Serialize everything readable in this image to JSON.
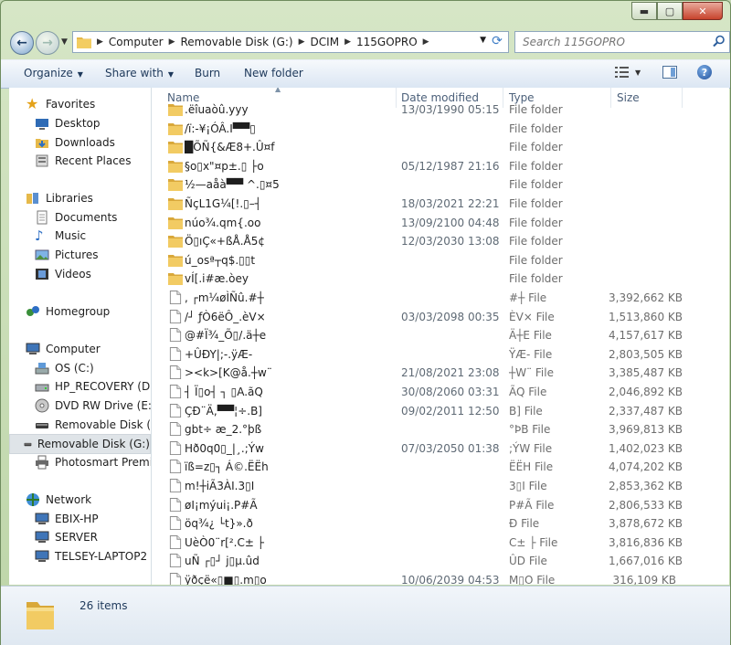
{
  "address": {
    "segments": [
      "Computer",
      "Removable Disk (G:)",
      "DCIM",
      "115GOPRO"
    ]
  },
  "search": {
    "placeholder": "Search 115GOPRO"
  },
  "toolbar": {
    "organize": "Organize",
    "share_with": "Share with",
    "burn": "Burn",
    "new_folder": "New folder"
  },
  "columns": {
    "name": "Name",
    "date": "Date modified",
    "type": "Type",
    "size": "Size"
  },
  "nav": {
    "favorites": "Favorites",
    "desktop": "Desktop",
    "downloads": "Downloads",
    "recent": "Recent Places",
    "libraries": "Libraries",
    "documents": "Documents",
    "music": "Music",
    "pictures": "Pictures",
    "videos": "Videos",
    "homegroup": "Homegroup",
    "computer": "Computer",
    "os": "OS (C:)",
    "recovery": "HP_RECOVERY (D:)",
    "dvd": "DVD RW Drive (E:)",
    "diskf": "Removable Disk (F:)",
    "diskg": "Removable Disk (G:)",
    "photosmart": "Photosmart Premium",
    "network": "Network",
    "ebix": "EBIX-HP",
    "server": "SERVER",
    "telsey": "TELSEY-LAPTOP2"
  },
  "files": [
    {
      "name": ".ëîuaòû.yyy",
      "date": "13/03/1990 05:15",
      "type": "File folder",
      "size": "",
      "kind": "folder"
    },
    {
      "name": "/ï:-¥¡ÓÂ.I▀▀▯",
      "date": "",
      "type": "File folder",
      "size": "",
      "kind": "folder"
    },
    {
      "name": "█ÕÑ{&Æ8+.Û¤f",
      "date": "",
      "type": "File folder",
      "size": "",
      "kind": "folder"
    },
    {
      "name": "§o▯x\"¤p±.▯ ├o",
      "date": "05/12/1987 21:16",
      "type": "File folder",
      "size": "",
      "kind": "folder"
    },
    {
      "name": "½—aåà▀▀ ^.▯¤5",
      "date": "",
      "type": "File folder",
      "size": "",
      "kind": "folder"
    },
    {
      "name": "ÑçL1G¼[!.▯–┤",
      "date": "18/03/2021 22:21",
      "type": "File folder",
      "size": "",
      "kind": "folder"
    },
    {
      "name": "núo¾.qm{.oo",
      "date": "13/09/2100 04:48",
      "type": "File folder",
      "size": "",
      "kind": "folder"
    },
    {
      "name": "Ö▯ıÇ«+ßÅ.Å5¢",
      "date": "12/03/2030 13:08",
      "type": "File folder",
      "size": "",
      "kind": "folder"
    },
    {
      "name": "ú_osª┬q$.▯▯t",
      "date": "",
      "type": "File folder",
      "size": "",
      "kind": "folder"
    },
    {
      "name": "vÍ[.i#æ.òey",
      "date": "",
      "type": "File folder",
      "size": "",
      "kind": "folder"
    },
    {
      "name": ", ┌m¼øÌÑû.#┼",
      "date": "",
      "type": "#┼ File",
      "size": "3,392,662 KB",
      "kind": "file"
    },
    {
      "name": "/┘ ƒÒ6ëÔ_.èV×",
      "date": "03/03/2098 00:35",
      "type": "ÈV× File",
      "size": "1,513,860 KB",
      "kind": "file"
    },
    {
      "name": "@#Ï¾_Õ▯/.ä┼e",
      "date": "",
      "type": "Ä┼E File",
      "size": "4,157,617 KB",
      "kind": "file"
    },
    {
      "name": "+ÛÐY|;-.ÿÆ-",
      "date": "",
      "type": "ŸÆ- File",
      "size": "2,803,505 KB",
      "kind": "file"
    },
    {
      "name": "><k>[K@å.┼w¨",
      "date": "21/08/2021 23:08",
      "type": "┼W¨ File",
      "size": "3,385,487 KB",
      "kind": "file"
    },
    {
      "name": "┤ Ï▯o┤ ┐ ▯A.ãQ",
      "date": "30/08/2060 03:31",
      "type": "ÃQ File",
      "size": "2,046,892 KB",
      "kind": "file"
    },
    {
      "name": "ÇÐ¨Ä,▀▀¦÷.B]",
      "date": "09/02/2011 12:50",
      "type": "B] File",
      "size": "2,337,487 KB",
      "kind": "file"
    },
    {
      "name": "gbt÷ æ_2.°þß",
      "date": "",
      "type": "°ÞB File",
      "size": "3,969,813 KB",
      "kind": "file"
    },
    {
      "name": "Hð0q0▯_|¸.;Ýw",
      "date": "07/03/2050 01:38",
      "type": ";ÝW File",
      "size": "1,402,023 KB",
      "kind": "file"
    },
    {
      "name": "ïß=z▯┐ Á©.ËËh",
      "date": "",
      "type": "ËËH File",
      "size": "4,074,202 KB",
      "kind": "file"
    },
    {
      "name": "m!┼iÃ3ÀI.3▯I",
      "date": "",
      "type": "3▯I File",
      "size": "2,853,362 KB",
      "kind": "file"
    },
    {
      "name": "øI¡mýui¡.P#Ã",
      "date": "",
      "type": "P#Ã File",
      "size": "2,806,533 KB",
      "kind": "file"
    },
    {
      "name": "öq¾¿ └t}».ð",
      "date": "",
      "type": "Ð File",
      "size": "3,878,672 KB",
      "kind": "file"
    },
    {
      "name": "UèÒ0¨r[².C± ├",
      "date": "",
      "type": "C± ├ File",
      "size": "3,816,836 KB",
      "kind": "file"
    },
    {
      "name": "uÑ ┌▯┘ j▯µ.ûd",
      "date": "",
      "type": "ÛD File",
      "size": "1,667,016 KB",
      "kind": "file"
    },
    {
      "name": "ÿðçë«▯■▯.m▯o",
      "date": "10/06/2039 04:53",
      "type": "M▯O File",
      "size": "316,109 KB",
      "kind": "file"
    }
  ],
  "status": {
    "count": "26 items"
  }
}
